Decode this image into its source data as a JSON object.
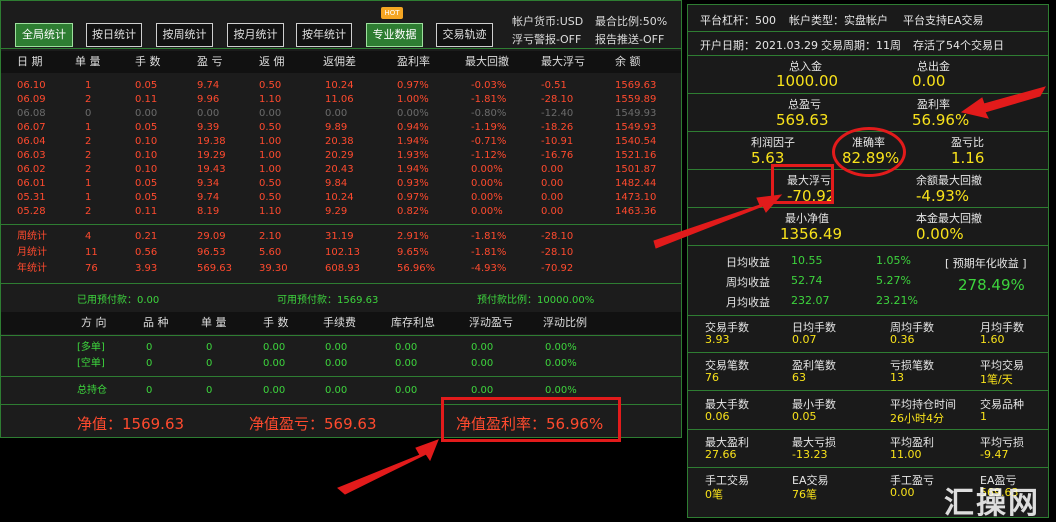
{
  "toolbar": {
    "buttons": [
      "全局统计",
      "按日统计",
      "按周统计",
      "按月统计",
      "按年统计",
      "专业数据",
      "交易轨迹"
    ],
    "hot_badge": "HOT",
    "info": [
      "帐户货币:USD",
      "浮亏警报-OFF",
      "最合比例:50%",
      "报告推送-OFF"
    ]
  },
  "daily_table": {
    "headers": [
      "日 期",
      "单 量",
      "手 数",
      "盈 亏",
      "返 佣",
      "返佣差",
      "盈利率",
      "最大回撤",
      "最大浮亏",
      "余 额"
    ],
    "rows": [
      [
        "06.10",
        "1",
        "0.05",
        "9.74",
        "0.50",
        "10.24",
        "0.97%",
        "-0.03%",
        "-0.51",
        "1569.63"
      ],
      [
        "06.09",
        "2",
        "0.11",
        "9.96",
        "1.10",
        "11.06",
        "1.00%",
        "-1.81%",
        "-28.10",
        "1559.89"
      ],
      [
        "06.08",
        "0",
        "0.00",
        "0.00",
        "0.00",
        "0.00",
        "0.00%",
        "-0.80%",
        "-12.40",
        "1549.93"
      ],
      [
        "06.07",
        "1",
        "0.05",
        "9.39",
        "0.50",
        "9.89",
        "0.94%",
        "-1.19%",
        "-18.26",
        "1549.93"
      ],
      [
        "06.04",
        "2",
        "0.10",
        "19.38",
        "1.00",
        "20.38",
        "1.94%",
        "-0.71%",
        "-10.91",
        "1540.54"
      ],
      [
        "06.03",
        "2",
        "0.10",
        "19.29",
        "1.00",
        "20.29",
        "1.93%",
        "-1.12%",
        "-16.76",
        "1521.16"
      ],
      [
        "06.02",
        "2",
        "0.10",
        "19.43",
        "1.00",
        "20.43",
        "1.94%",
        "0.00%",
        "0.00",
        "1501.87"
      ],
      [
        "06.01",
        "1",
        "0.05",
        "9.34",
        "0.50",
        "9.84",
        "0.93%",
        "0.00%",
        "0.00",
        "1482.44"
      ],
      [
        "05.31",
        "1",
        "0.05",
        "9.74",
        "0.50",
        "10.24",
        "0.97%",
        "0.00%",
        "0.00",
        "1473.10"
      ],
      [
        "05.28",
        "2",
        "0.11",
        "8.19",
        "1.10",
        "9.29",
        "0.82%",
        "0.00%",
        "0.00",
        "1463.36"
      ]
    ],
    "row_gray": [
      false,
      false,
      true,
      false,
      false,
      false,
      false,
      false,
      false,
      false
    ],
    "summary": [
      [
        "周统计",
        "4",
        "0.21",
        "29.09",
        "2.10",
        "31.19",
        "2.91%",
        "-1.81%",
        "-28.10"
      ],
      [
        "月统计",
        "11",
        "0.56",
        "96.53",
        "5.60",
        "102.13",
        "9.65%",
        "-1.81%",
        "-28.10"
      ],
      [
        "年统计",
        "76",
        "3.93",
        "569.63",
        "39.30",
        "608.93",
        "56.96%",
        "-4.93%",
        "-70.92"
      ]
    ]
  },
  "prepay": {
    "used": "已用预付款：0.00",
    "available": "可用预付款：1569.63",
    "ratio": "预付款比例：10000.00%"
  },
  "positions_table": {
    "headers": [
      "方 向",
      "品 种",
      "单 量",
      "手 数",
      "手续费",
      "库存利息",
      "浮动盈亏",
      "浮动比例"
    ],
    "rows": [
      [
        "[多单]",
        "0",
        "0",
        "0.00",
        "0.00",
        "0.00",
        "0.00",
        "0.00%"
      ],
      [
        "[空单]",
        "0",
        "0",
        "0.00",
        "0.00",
        "0.00",
        "0.00",
        "0.00%"
      ]
    ],
    "total": [
      "总持仓",
      "0",
      "0",
      "0.00",
      "0.00",
      "0.00",
      "0.00",
      "0.00%"
    ]
  },
  "bottom": {
    "net_value": "净值：1569.63",
    "net_profit": "净值盈亏：569.63",
    "net_profit_rate": "净值盈利率：56.96%"
  },
  "account": {
    "leverage": "平台杠杆：500",
    "account_type": "帐户类型：实盘帐户",
    "ea_support": "平台支持EA交易",
    "open_date": "开户日期：2021.03.29",
    "trade_period": "交易周期：11周",
    "survived": "存活了54个交易日"
  },
  "stats": {
    "deposit_label": "总入金",
    "deposit": "1000.00",
    "withdraw_label": "总出金",
    "withdraw": "0.00",
    "profit_label": "总盈亏",
    "profit": "569.63",
    "profit_rate_label": "盈利率",
    "profit_rate": "56.96%",
    "profit_factor_label": "利润因子",
    "profit_factor": "5.63",
    "accuracy_label": "准确率",
    "accuracy": "82.89%",
    "pl_ratio_label": "盈亏比",
    "pl_ratio": "1.16",
    "max_float_loss_label": "最大浮亏",
    "max_float_loss": "-70.92",
    "max_drawdown_label": "余额最大回撤",
    "max_drawdown": "-4.93%",
    "min_equity_label": "最小净值",
    "min_equity": "1356.49",
    "principal_drawdown_label": "本金最大回撤",
    "principal_drawdown": "0.00%"
  },
  "returns": {
    "daily_label": "日均收益",
    "daily_value": "10.55",
    "daily_pct": "1.05%",
    "weekly_label": "周均收益",
    "weekly_value": "52.74",
    "weekly_pct": "5.27%",
    "monthly_label": "月均收益",
    "monthly_value": "232.07",
    "monthly_pct": "23.21%",
    "annual_label": "[ 预期年化收益 ]",
    "annual_value": "278.49%"
  },
  "trade_grid": [
    [
      [
        "交易手数",
        "3.93"
      ],
      [
        "日均手数",
        "0.07"
      ],
      [
        "周均手数",
        "0.36"
      ],
      [
        "月均手数",
        "1.60"
      ]
    ],
    [
      [
        "交易笔数",
        "76"
      ],
      [
        "盈利笔数",
        "63"
      ],
      [
        "亏损笔数",
        "13"
      ],
      [
        "平均交易",
        "1笔/天"
      ]
    ],
    [
      [
        "最大手数",
        "0.06"
      ],
      [
        "最小手数",
        "0.05"
      ],
      [
        "平均持仓时间",
        "26小时4分"
      ],
      [
        "交易品种",
        "1"
      ]
    ],
    [
      [
        "最大盈利",
        "27.66"
      ],
      [
        "最大亏损",
        "-13.23"
      ],
      [
        "平均盈利",
        "11.00"
      ],
      [
        "平均亏损",
        "-9.47"
      ]
    ],
    [
      [
        "手工交易",
        "0笔"
      ],
      [
        "EA交易",
        "76笔"
      ],
      [
        "手工盈亏",
        "0.00"
      ],
      [
        "EA盈亏",
        "569.63"
      ]
    ]
  ],
  "watermark": "汇操网",
  "colors": {
    "accent_green": "#3dd43d",
    "loss_red": "#ff4a2e",
    "value_yellow": "#f8e21b",
    "annotation_red": "#e21b1b"
  }
}
